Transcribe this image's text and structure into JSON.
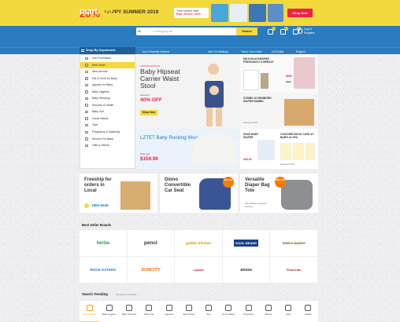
{
  "promo": {
    "percent": "20%",
    "headline": "HAPPY SUMMER 2019",
    "offer_line1": "Time Limited Offer",
    "offer_line2": "Expr. 25 Dec. 2019",
    "shop_now": "Shop Now"
  },
  "header": {
    "logo_main": "mart",
    "logo_accent": "fury",
    "search_category": "All",
    "search_placeholder": "I'm shopping for...",
    "search_button": "Search",
    "compare_count": "0",
    "wishlist_count": "0",
    "cart_count": "0",
    "login_line1": "Log in",
    "login_line2": "Register"
  },
  "nav": {
    "shop_by_department": "Shop By Department",
    "recently_viewed": "Your Recently Viewed",
    "sell_on": "Sell On Martfury",
    "track": "Track Your Order",
    "currency": "US Dollar",
    "language": "English"
  },
  "sidebar": {
    "items": [
      {
        "label": "Hot Promotions"
      },
      {
        "label": "Best Seller"
      },
      {
        "label": "New Arrivals"
      },
      {
        "label": "Eat & Drink for Baby"
      },
      {
        "label": "Apparel for Baby"
      },
      {
        "label": "Baby Hygiene"
      },
      {
        "label": "Baby Sleeping"
      },
      {
        "label": "Seoures & Health"
      },
      {
        "label": "Baby Out"
      },
      {
        "label": "Home Wares"
      },
      {
        "label": "Toys"
      },
      {
        "label": "Pregnancy & Maternity"
      },
      {
        "label": "Shower For Baby"
      },
      {
        "label": "Gifts & Others"
      }
    ]
  },
  "banner": {
    "limited": "LIMITED EDITION",
    "title": "Baby Hipseat Carrier Waist Stool",
    "discount_label": "Discount",
    "discount": "40% OFF",
    "shop_now": "Shop Now"
  },
  "right_promos": {
    "p1_title": "ME-N BLACKMORES PREGNANCY & BREAST",
    "p1_price": "$599",
    "p1_old": "$699",
    "p2_title": "COMBO 10 NEWBORN DIAPER BAMBO",
    "p2_disc": "Discount 20%",
    "p3_title": "SNAP BABY DIAPER",
    "p3_price": "$45.00",
    "p4_title": "VOUCHER BOOK CASE AT BABYLIA SPA",
    "p4_disc": "Discount 30%"
  },
  "chair": {
    "title": "LZTET Baby Rocking Wood Chair",
    "price_label": "Price just",
    "price": "$159.99"
  },
  "mid": {
    "m1_title": "Freeship for orders in Local",
    "m1_phone": "1800-6048",
    "m2_title": "Diono Convertible Car Seat",
    "m2_badge": "20% OFF",
    "m3_title": "Versatile Diaper Bag Tote",
    "m3_badge": "30% OFF",
    "m3_sub": "with Multiple Separate Pockets"
  },
  "brands": {
    "section_title": "Best Seller Brands",
    "items": [
      "herba",
      "pencl",
      "golden kitchen",
      "KOOL BEANS",
      "TEMPLE BAKERY",
      "BOOK EATERS",
      "SUNCITY",
      "Lipstick",
      "BISON",
      "FilmCritic"
    ]
  },
  "trending": {
    "section_title": "Search Trending",
    "updated": "Updated at 9:00AM",
    "items": [
      "Hot Trending",
      "Baby Hygiene",
      "Baby Sleeping",
      "Baby Out",
      "Apparels",
      "Eat & Drink",
      "Toys",
      "Home Wares",
      "Pregnancy",
      "Shower",
      "Gifts",
      "Health"
    ]
  },
  "colors": {
    "brand_blue": "#2a7bc0",
    "accent_yellow": "#f4d93d",
    "sale_red": "#e24"
  }
}
